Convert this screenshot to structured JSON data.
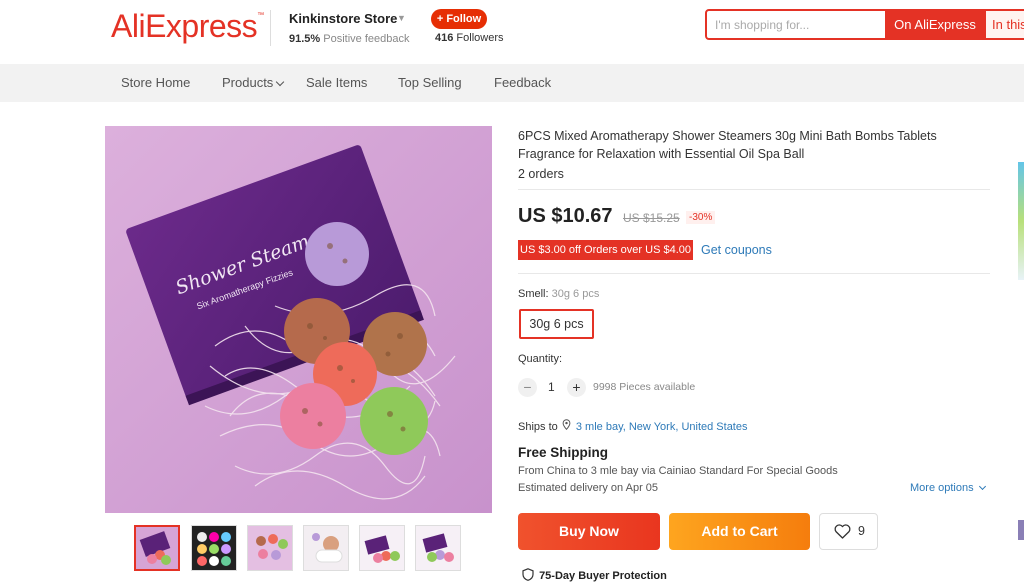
{
  "header": {
    "logo": "AliExpress",
    "store_name": "Kinkinstore Store",
    "feedback_percent": "91.5%",
    "feedback_label": "Positive feedback",
    "follow_label": "+ Follow",
    "followers_count": "416",
    "followers_label": "Followers",
    "search_placeholder": "I'm shopping for...",
    "search_on_ali": "On AliExpress",
    "search_in_store": "In this"
  },
  "nav": {
    "items": [
      "Store Home",
      "Products",
      "Sale Items",
      "Top Selling",
      "Feedback"
    ]
  },
  "product": {
    "title": "6PCS Mixed Aromatherapy Shower Steamers 30g Mini Bath Bombs Tablets Fragrance for Relaxation with Essential Oil Spa Ball",
    "orders": "2 orders",
    "price": "US $10.67",
    "old_price": "US $15.25",
    "discount": "-30%",
    "coupon": "US $3.00 off Orders over US $4.00",
    "get_coupons": "Get coupons",
    "smell_label": "Smell:",
    "smell_value": "30g 6 pcs",
    "sku_option": "30g 6 pcs",
    "quantity_label": "Quantity:",
    "quantity_minus": "−",
    "quantity_value": "1",
    "quantity_plus": "+",
    "available": "9998 Pieces available",
    "ships_to_label": "Ships to",
    "ships_to_location": "3 mle bay, New York, United States",
    "free_shipping": "Free Shipping",
    "ship_from": "From China to 3 mle bay via Cainiao Standard For Special Goods",
    "delivery": "Estimated delivery on Apr 05",
    "more_options": "More options",
    "buy_now": "Buy Now",
    "add_to_cart": "Add to Cart",
    "wishlist_count": "9",
    "protection": "75-Day Buyer Protection"
  },
  "image": {
    "box_text_1": "Shower Steamers",
    "box_text_2": "Six Aromatherapy Fizzies"
  },
  "colors": {
    "brand_red": "#e43225",
    "buy_now": "#ef4a27",
    "add_to_cart": "#fa9a18",
    "link_blue": "#2e7ab8"
  }
}
